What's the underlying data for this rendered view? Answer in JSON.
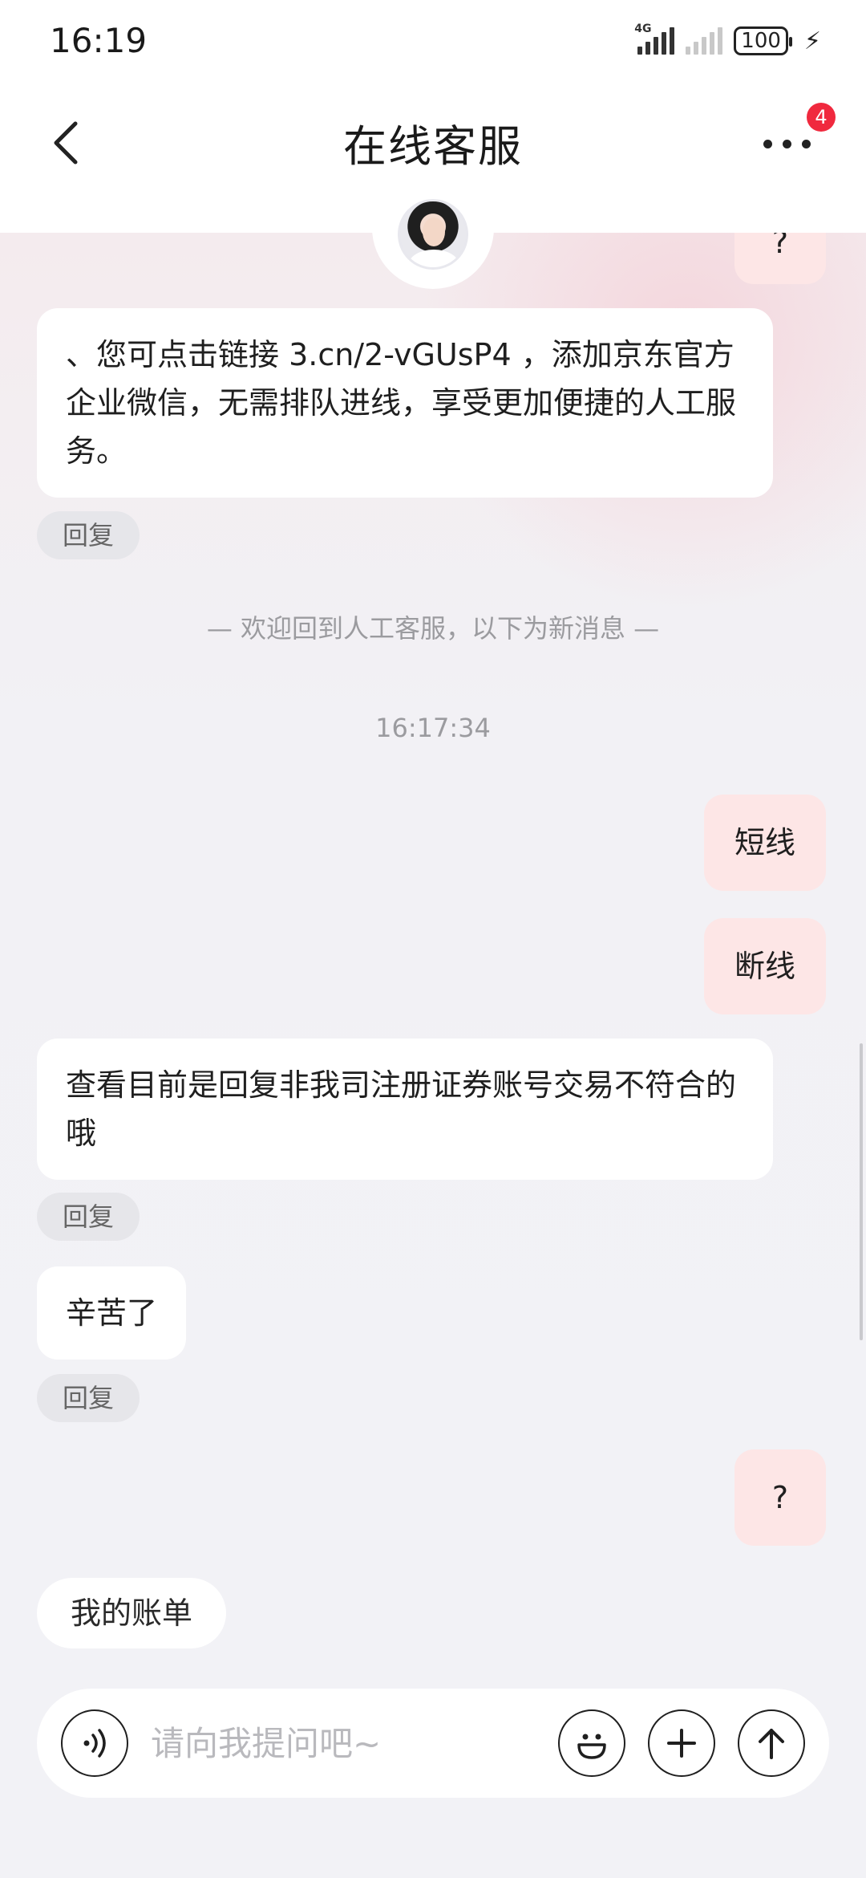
{
  "status_bar": {
    "time": "16:19",
    "network_label": "4G",
    "battery": "100"
  },
  "header": {
    "title": "在线客服",
    "badge_count": "4"
  },
  "messages": [
    {
      "side": "right",
      "text": "?"
    },
    {
      "side": "left",
      "text": "、您可点击链接 3.cn/2-vGUsP4 ，添加京东官方企业微信，无需排队进线，享受更加便捷的人工服务。",
      "reply_label": "回复"
    },
    {
      "side": "system",
      "text": "— 欢迎回到人工客服，以下为新消息 —"
    },
    {
      "side": "time",
      "text": "16:17:34"
    },
    {
      "side": "right",
      "text": "短线"
    },
    {
      "side": "right",
      "text": "断线"
    },
    {
      "side": "left",
      "text": "查看目前是回复非我司注册证券账号交易不符合的哦",
      "reply_label": "回复"
    },
    {
      "side": "left",
      "text": "辛苦了",
      "reply_label": "回复"
    },
    {
      "side": "right",
      "text": "?"
    }
  ],
  "quick_actions": [
    "我的账单"
  ],
  "input": {
    "placeholder": "请向我提问吧~",
    "value": ""
  },
  "icons": {
    "back": "chevron-left-icon",
    "more": "more-dots-icon",
    "voice": "voice-icon",
    "emoji": "emoji-icon",
    "add": "plus-icon",
    "send": "arrow-up-icon"
  },
  "colors": {
    "badge": "#f0293e",
    "user_bubble": "#fde6e6",
    "agent_bubble": "#ffffff"
  }
}
